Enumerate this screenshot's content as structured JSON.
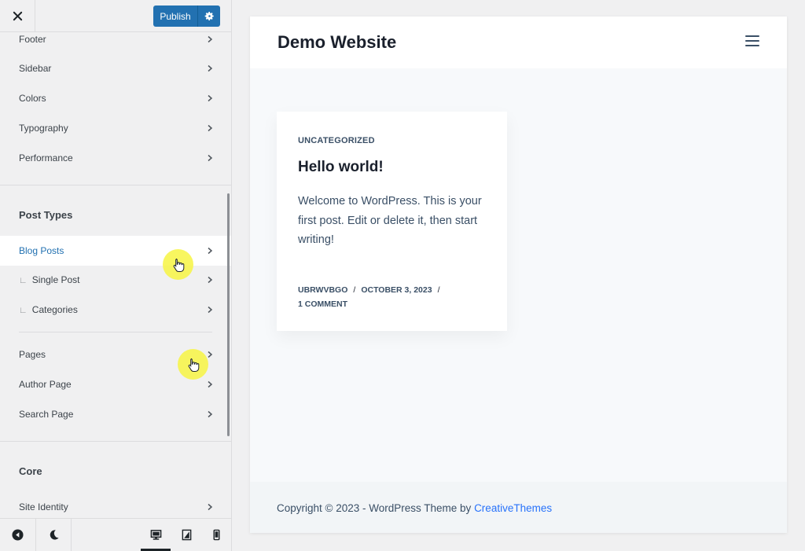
{
  "header": {
    "close_icon": "close-icon",
    "publish_label": "Publish",
    "settings_icon": "gear-icon"
  },
  "panel": {
    "general_items": [
      {
        "label": "Footer"
      },
      {
        "label": "Sidebar"
      },
      {
        "label": "Colors"
      },
      {
        "label": "Typography"
      },
      {
        "label": "Performance"
      }
    ],
    "post_types_title": "Post Types",
    "post_types_items": [
      {
        "label": "Blog Posts",
        "active": true
      },
      {
        "label": "Single Post",
        "sub": true
      },
      {
        "label": "Categories",
        "sub": true
      }
    ],
    "page_items": [
      {
        "label": "Pages"
      },
      {
        "label": "Author Page"
      },
      {
        "label": "Search Page"
      }
    ],
    "core_title": "Core",
    "core_items": [
      {
        "label": "Site Identity"
      }
    ],
    "sub_marker": "∟"
  },
  "footer_bar": {
    "hide_controls_icon": "collapse-icon",
    "dark_mode_icon": "moon-icon",
    "devices": [
      {
        "name": "desktop",
        "icon": "desktop-icon",
        "active": true
      },
      {
        "name": "tablet",
        "icon": "tablet-icon"
      },
      {
        "name": "mobile",
        "icon": "mobile-icon"
      }
    ]
  },
  "preview": {
    "site_title": "Demo Website",
    "menu_icon": "hamburger-icon",
    "post": {
      "category": "UNCATEGORIZED",
      "title": "Hello world!",
      "excerpt": "Welcome to WordPress. This is your first post. Edit or delete it, then start writing!",
      "author": "UBRWVBGO",
      "date": "OCTOBER 3, 2023",
      "comments": "1 COMMENT",
      "separator": "/"
    },
    "footer": {
      "copyright_prefix": "Copyright © 2023 - WordPress Theme by ",
      "theme_link": "CreativeThemes"
    }
  },
  "colors": {
    "accent": "#2271b1",
    "link": "#2872fa",
    "cursor_highlight": "#f7f443"
  }
}
